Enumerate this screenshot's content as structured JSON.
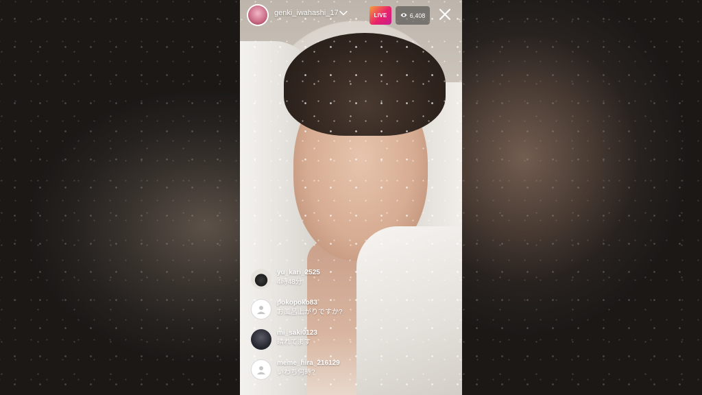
{
  "live": {
    "host_username": "genki_iwahashi_17",
    "live_label": "LIVE",
    "viewer_count": "6,408",
    "icons": {
      "dropdown": "chevron-down-icon",
      "viewers": "eye-icon",
      "close": "close-icon"
    },
    "badge_gradient": [
      "#f7a23a",
      "#e8226a",
      "#c71e8e"
    ]
  },
  "comments": [
    {
      "username": "yu_kari_2525",
      "text": "4時48分",
      "avatar": "black-cat-avatar"
    },
    {
      "username": "pokopoko83",
      "text": "お風呂上がりですか?",
      "avatar": "default-avatar"
    },
    {
      "username": "mi_saki0123",
      "text": "晴れてます",
      "avatar": "photo-avatar"
    },
    {
      "username": "meme_hira_216129",
      "text": "いわち何時?",
      "avatar": "default-avatar"
    }
  ]
}
